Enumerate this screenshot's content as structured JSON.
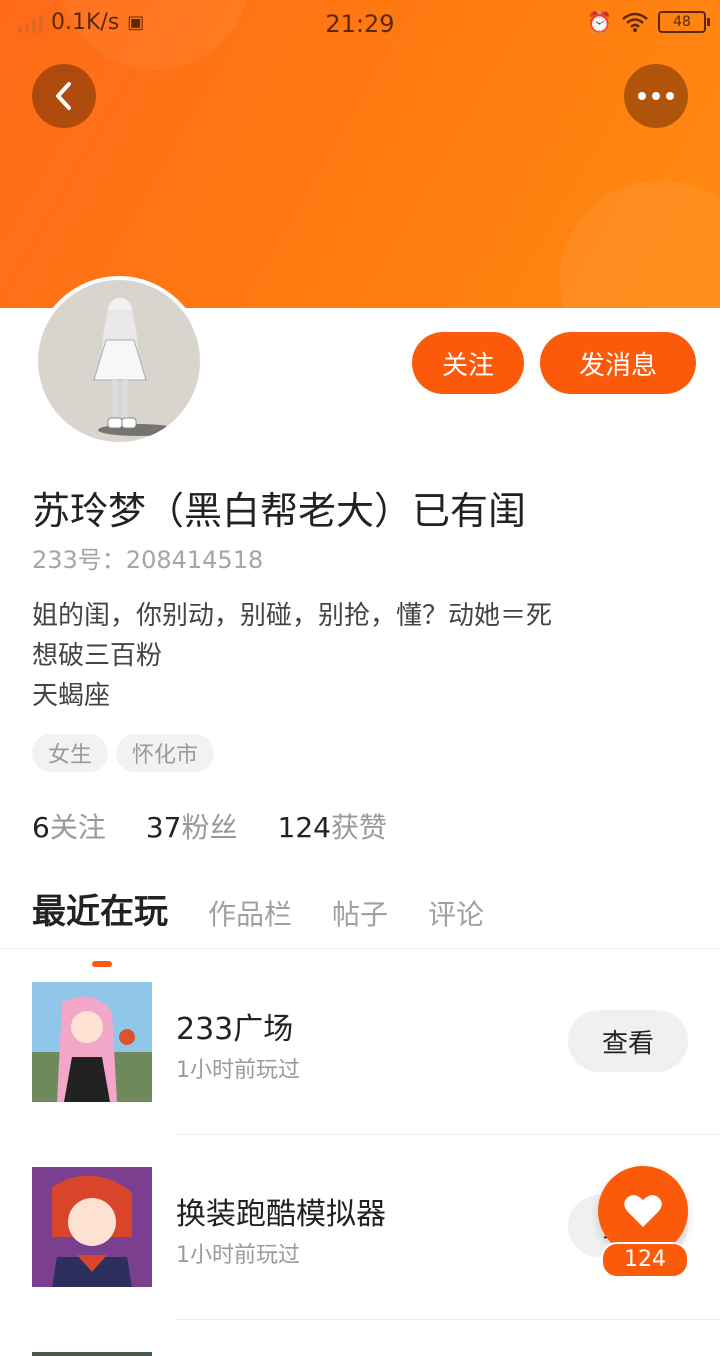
{
  "status_bar": {
    "speed": "0.1K/s",
    "time": "21:29",
    "battery": "48"
  },
  "profile": {
    "name": "苏玲梦（黑白帮老大）已有闺",
    "uid": "233号：208414518",
    "bio": [
      "姐的闺，你别动，别碰，别抢，懂？动她＝死",
      "想破三百粉",
      "天蝎座"
    ],
    "tags": [
      "女生",
      "怀化市"
    ],
    "follow_label": "关注",
    "message_label": "发消息"
  },
  "stats": {
    "following_count": "6",
    "following_label": "关注",
    "fans_count": "37",
    "fans_label": "粉丝",
    "likes_count": "124",
    "likes_label": "获赞"
  },
  "tabs": [
    "最近在玩",
    "作品栏",
    "帖子",
    "评论"
  ],
  "games": [
    {
      "title": "233广场",
      "sub": "1小时前玩过",
      "action": "查看"
    },
    {
      "title": "换装跑酷模拟器",
      "sub": "1小时前玩过",
      "action": "查看"
    }
  ],
  "like_fab": {
    "count": "124"
  },
  "colors": {
    "accent": "#fb5a0b",
    "banner": "#ff7a12"
  }
}
